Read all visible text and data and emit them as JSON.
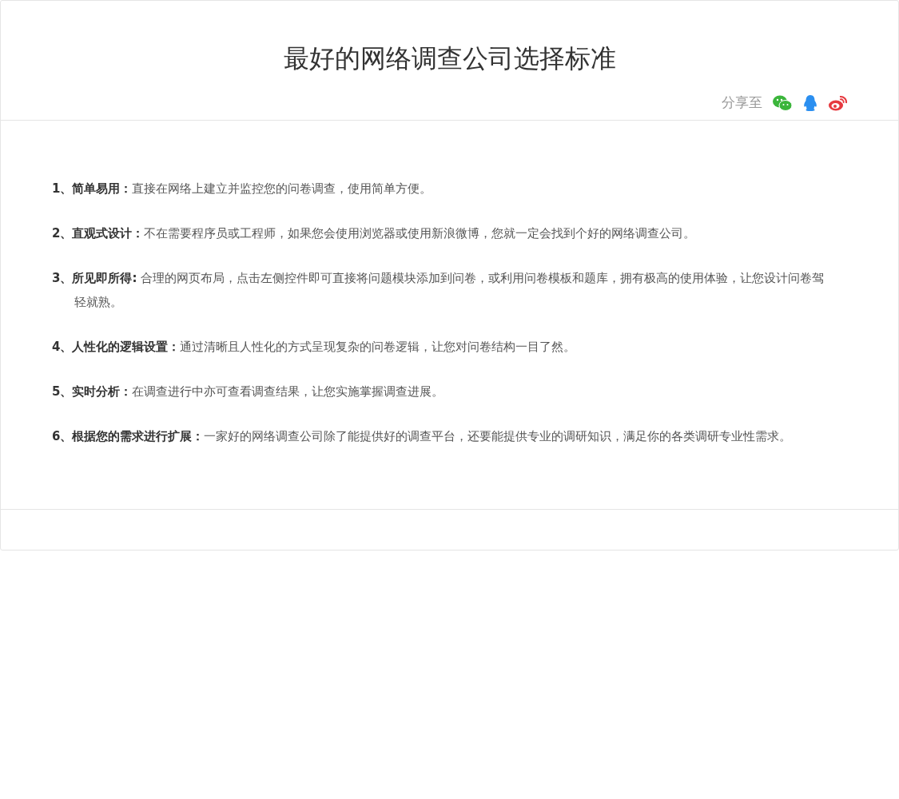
{
  "article": {
    "title": "最好的网络调查公司选择标准",
    "share": {
      "label": "分享至",
      "targets": [
        {
          "kind": "wechat"
        },
        {
          "kind": "qq"
        },
        {
          "kind": "weibo"
        }
      ]
    },
    "points": [
      "**1、简单易用：**直接在网络上建立并监控您的问卷调查，使用简单方便。",
      "**2、直观式设计：**不在需要程序员或工程师，如果您会使用浏览器或使用新浪微博，您就一定会找到个好的网络调查公司。",
      "**3、所见即所得:** 合理的网页布局，点击左侧控件即可直接将问题模块添加到问卷，或利用问卷模板和题库，拥有极高的使用体验，让您设计问卷驾轻就熟。",
      "**4、人性化的逻辑设置：**通过清晰且人性化的方式呈现复杂的问卷逻辑，让您对问卷结构一目了然。",
      "**5、实时分析：**在调查进行中亦可查看调查结果，让您实施掌握调查进展。",
      "**6、根据您的需求进行扩展：**一家好的网络调查公司除了能提供好的调查平台，还要能提供专业的调研知识，满足你的各类调研专业性需求。"
    ]
  }
}
